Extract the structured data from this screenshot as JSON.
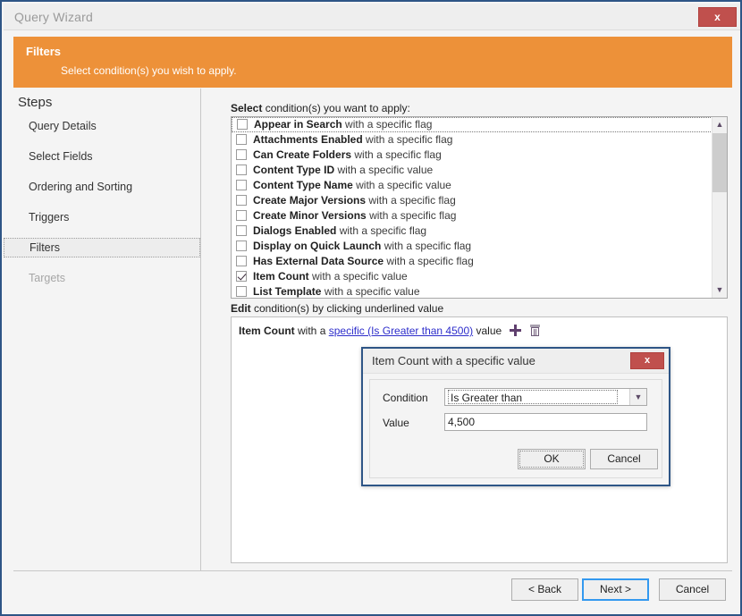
{
  "window": {
    "title": "Query Wizard",
    "close_label": "x"
  },
  "banner": {
    "title": "Filters",
    "subtitle": "Select condition(s) you wish to apply."
  },
  "sidebar": {
    "heading": "Steps",
    "items": [
      {
        "label": "Query Details",
        "state": "normal"
      },
      {
        "label": "Select Fields",
        "state": "normal"
      },
      {
        "label": "Ordering and Sorting",
        "state": "normal"
      },
      {
        "label": "Triggers",
        "state": "normal"
      },
      {
        "label": "Filters",
        "state": "active"
      },
      {
        "label": "Targets",
        "state": "disabled"
      }
    ]
  },
  "main": {
    "select_label_bold": "Select",
    "select_label_rest": " condition(s) you want to apply:",
    "conditions": [
      {
        "name": "Appear in Search",
        "descriptor": "with a specific flag",
        "checked": false,
        "focused": true
      },
      {
        "name": "Attachments Enabled",
        "descriptor": "with a specific flag",
        "checked": false,
        "focused": false
      },
      {
        "name": "Can Create Folders",
        "descriptor": "with a specific flag",
        "checked": false,
        "focused": false
      },
      {
        "name": "Content Type ID",
        "descriptor": "with a specific value",
        "checked": false,
        "focused": false
      },
      {
        "name": "Content Type Name",
        "descriptor": "with a specific value",
        "checked": false,
        "focused": false
      },
      {
        "name": "Create Major Versions",
        "descriptor": "with a specific flag",
        "checked": false,
        "focused": false
      },
      {
        "name": "Create Minor Versions",
        "descriptor": "with a specific flag",
        "checked": false,
        "focused": false
      },
      {
        "name": "Dialogs Enabled",
        "descriptor": "with a specific flag",
        "checked": false,
        "focused": false
      },
      {
        "name": "Display on Quick Launch",
        "descriptor": "with a specific flag",
        "checked": false,
        "focused": false
      },
      {
        "name": "Has External Data Source",
        "descriptor": "with a specific flag",
        "checked": false,
        "focused": false
      },
      {
        "name": "Item Count",
        "descriptor": "with a specific value",
        "checked": true,
        "focused": false
      },
      {
        "name": "List Template",
        "descriptor": "with a specific value",
        "checked": false,
        "focused": false
      }
    ],
    "scrollbar": {
      "up_icon": "chevron-up",
      "down_icon": "chevron-down"
    },
    "edit_label_bold": "Edit",
    "edit_label_rest": " condition(s) by clicking underlined value",
    "condition_row": {
      "field": "Item Count",
      "prefix": "with a",
      "link": "specific (Is Greater than 4500)",
      "suffix": "value",
      "add_icon": "plus-icon",
      "delete_icon": "trash-icon"
    }
  },
  "footer": {
    "back_label": "< Back",
    "next_label": "Next >",
    "cancel_label": "Cancel"
  },
  "modal": {
    "title": "Item Count with a specific value",
    "close_label": "x",
    "condition_label": "Condition",
    "condition_value": "Is Greater than",
    "condition_options": [
      "Is Greater than"
    ],
    "value_label": "Value",
    "value_value": "4,500",
    "value_placeholder": "",
    "ok_label": "OK",
    "cancel_label": "Cancel",
    "dropdown_icon": "chevron-down"
  },
  "colors": {
    "banner": "#ed9139",
    "close_red": "#c0504d",
    "window_border": "#2e5586",
    "link": "#2e2ecb",
    "default_button_border": "#3399ef"
  }
}
